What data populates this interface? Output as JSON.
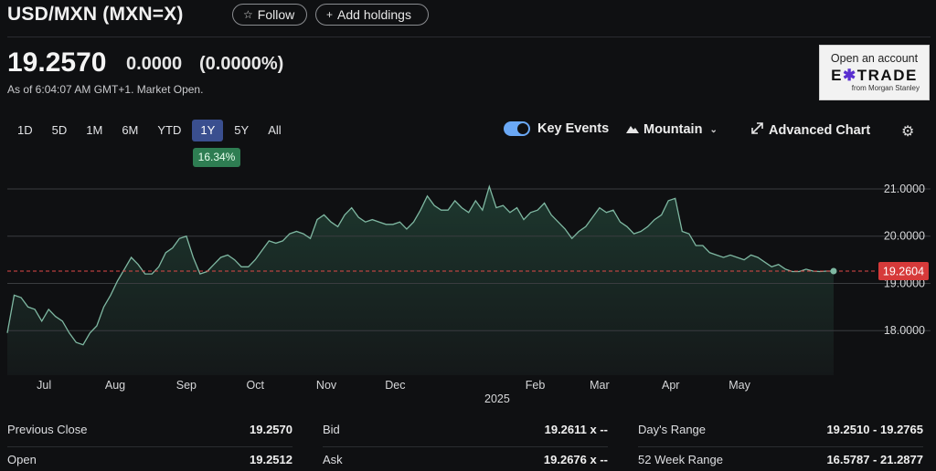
{
  "header": {
    "title": "USD/MXN (MXN=X)",
    "follow_label": "Follow",
    "add_holdings_label": "Add holdings"
  },
  "quote": {
    "price": "19.2570",
    "change": "0.0000",
    "change_pct": "(0.0000%)",
    "as_of": "As of 6:04:07 AM GMT+1. Market Open."
  },
  "ad": {
    "line1": "Open an account",
    "brand": "E*TRADE",
    "line3": "from Morgan Stanley"
  },
  "toolbar": {
    "ranges": [
      "1D",
      "5D",
      "1M",
      "6M",
      "YTD",
      "1Y",
      "5Y",
      "All"
    ],
    "active_range": "1Y",
    "range_change": "16.34%",
    "key_events_label": "Key Events",
    "key_events_on": true,
    "chart_type_label": "Mountain",
    "advanced_label": "Advanced Chart"
  },
  "colors": {
    "line": "#7fb8a2",
    "area_top": "#1e3a30",
    "ref_line": "#e04848",
    "ref_badge": "#d63a3a",
    "toggle": "#6aa8f5",
    "active_range_bg": "#3a4f8f",
    "badge_bg": "#2e7d52"
  },
  "chart_data": {
    "type": "area",
    "ylim": [
      17.25,
      21.25
    ],
    "yticks": [
      "21.0000",
      "20.0000",
      "19.0000",
      "18.0000"
    ],
    "ytick_values": [
      21,
      20,
      19,
      18
    ],
    "xtick_labels": [
      "Jul",
      "Aug",
      "Sep",
      "Oct",
      "Nov",
      "Dec",
      "Feb",
      "Mar",
      "Apr",
      "May"
    ],
    "xtick_days": [
      16,
      47,
      78,
      108,
      139,
      169,
      230,
      258,
      289,
      319
    ],
    "year_label": "2025",
    "current_value": "19.2604",
    "current_y": 19.26,
    "series": [
      {
        "x": [
          0,
          3,
          6,
          9,
          12,
          15,
          18,
          21,
          24,
          27,
          30,
          33,
          36,
          39,
          42,
          45,
          48,
          51,
          54,
          57,
          60,
          63,
          66,
          69,
          72,
          75,
          78,
          81,
          84,
          87,
          90,
          93,
          96,
          99,
          102,
          105,
          108,
          111,
          114,
          117,
          120,
          123,
          126,
          129,
          132,
          135,
          138,
          141,
          144,
          147,
          150,
          153,
          156,
          159,
          162,
          165,
          168,
          171,
          174,
          177,
          180,
          183,
          186,
          189,
          192,
          195,
          198,
          201,
          204,
          207,
          210,
          213,
          216,
          219,
          222,
          225,
          228,
          231,
          234,
          237,
          240,
          243,
          246,
          249,
          252,
          255,
          258,
          261,
          264,
          267,
          270,
          273,
          276,
          279,
          282,
          285,
          288,
          291,
          294,
          297,
          300,
          303,
          306,
          309,
          312,
          315,
          318,
          321,
          324,
          327,
          330,
          333,
          336,
          339,
          342,
          345,
          348,
          351,
          354,
          357,
          360
        ],
        "y": [
          17.95,
          18.75,
          18.7,
          18.5,
          18.45,
          18.2,
          18.45,
          18.3,
          18.2,
          17.95,
          17.75,
          17.7,
          17.95,
          18.1,
          18.5,
          18.75,
          19.05,
          19.3,
          19.55,
          19.4,
          19.2,
          19.2,
          19.35,
          19.65,
          19.75,
          19.95,
          20.0,
          19.55,
          19.2,
          19.25,
          19.4,
          19.55,
          19.6,
          19.5,
          19.35,
          19.35,
          19.5,
          19.7,
          19.9,
          19.85,
          19.9,
          20.05,
          20.1,
          20.05,
          19.95,
          20.35,
          20.45,
          20.3,
          20.2,
          20.45,
          20.6,
          20.4,
          20.3,
          20.35,
          20.3,
          20.25,
          20.25,
          20.3,
          20.15,
          20.3,
          20.55,
          20.85,
          20.65,
          20.55,
          20.55,
          20.75,
          20.6,
          20.5,
          20.75,
          20.55,
          21.05,
          20.6,
          20.65,
          20.5,
          20.6,
          20.35,
          20.5,
          20.55,
          20.7,
          20.45,
          20.3,
          20.15,
          19.95,
          20.1,
          20.2,
          20.4,
          20.6,
          20.5,
          20.55,
          20.3,
          20.2,
          20.05,
          20.1,
          20.2,
          20.35,
          20.45,
          20.75,
          20.8,
          20.1,
          20.05,
          19.8,
          19.8,
          19.65,
          19.6,
          19.55,
          19.6,
          19.55,
          19.5,
          19.6,
          19.55,
          19.45,
          19.35,
          19.4,
          19.3,
          19.25,
          19.25,
          19.3,
          19.26,
          19.25,
          19.26,
          19.26
        ]
      }
    ]
  },
  "stats": {
    "col1": [
      {
        "label": "Previous Close",
        "value": "19.2570"
      },
      {
        "label": "Open",
        "value": "19.2512"
      }
    ],
    "col2": [
      {
        "label": "Bid",
        "value": "19.2611 x --"
      },
      {
        "label": "Ask",
        "value": "19.2676 x --"
      }
    ],
    "col3": [
      {
        "label": "Day's Range",
        "value": "19.2510 - 19.2765"
      },
      {
        "label": "52 Week Range",
        "value": "16.5787 - 21.2877"
      }
    ]
  }
}
